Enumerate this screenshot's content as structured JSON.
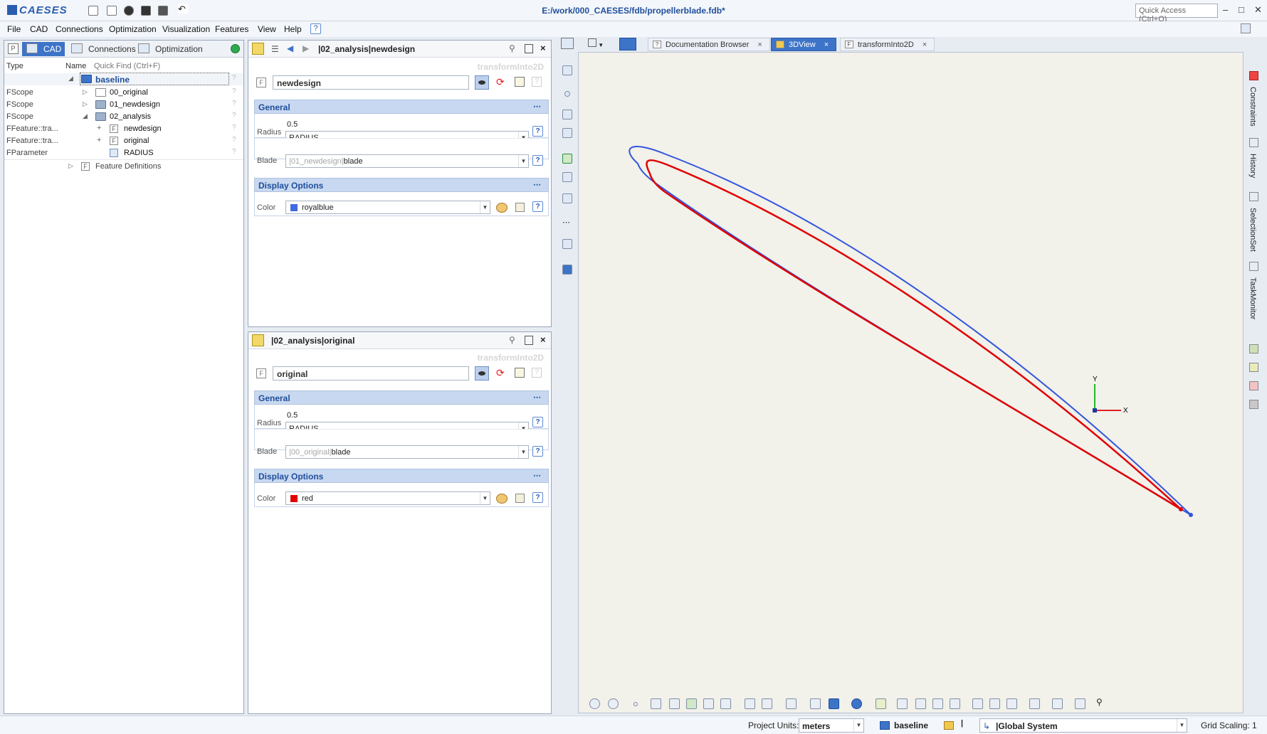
{
  "app": {
    "logo": "CAESES",
    "window_title": "E:/work/000_CAESES/fdb/propellerblade.fdb*",
    "quick_access_placeholder": "Quick Access (Ctrl+Q)"
  },
  "menu": [
    "File",
    "CAD",
    "Connections",
    "Optimization",
    "Visualization",
    "Features",
    "View",
    "Help"
  ],
  "left_panel": {
    "tabs": [
      "CAD",
      "Connections",
      "Optimization"
    ],
    "active_tab": "CAD",
    "columns": {
      "type": "Type",
      "name": "Name",
      "quick_find": "Quick Find (Ctrl+F)"
    },
    "tree": [
      {
        "type": "",
        "name": "baseline"
      },
      {
        "type": "FScope",
        "name": "00_original"
      },
      {
        "type": "FScope",
        "name": "01_newdesign"
      },
      {
        "type": "FScope",
        "name": "02_analysis"
      },
      {
        "type": "FFeature::tra...",
        "name": "newdesign"
      },
      {
        "type": "FFeature::tra...",
        "name": "original"
      },
      {
        "type": "FParameter",
        "name": "RADIUS"
      },
      {
        "type": "",
        "name": "Feature Definitions"
      }
    ]
  },
  "editors": [
    {
      "title": "|02_analysis|newdesign",
      "transform_label": "transformInto2D",
      "name": "newdesign",
      "general_label": "General",
      "radius_label": "Radius",
      "radius_value": "0.5",
      "radius_expr": "RADIUS",
      "blade_label": "Blade",
      "blade_scope": "|01_newdesign|",
      "blade_value": "blade",
      "display_label": "Display Options",
      "color_label": "Color",
      "color_value": "royalblue",
      "color_hex": "#4169e1"
    },
    {
      "title": "|02_analysis|original",
      "transform_label": "transformInto2D",
      "name": "original",
      "general_label": "General",
      "radius_label": "Radius",
      "radius_value": "0.5",
      "radius_expr": "RADIUS",
      "blade_label": "Blade",
      "blade_scope": "|00_original|",
      "blade_value": "blade",
      "display_label": "Display Options",
      "color_label": "Color",
      "color_value": "red",
      "color_hex": "#e00000"
    }
  ],
  "view_tabs": [
    {
      "label": "Documentation Browser",
      "active": false
    },
    {
      "label": "3DView",
      "active": true
    },
    {
      "label": "transformInto2D",
      "active": false
    }
  ],
  "view3d": {
    "axis_y": "Y",
    "axis_x": "X",
    "curve_blue": "#3355dd",
    "curve_red": "#e00000"
  },
  "right_strip": [
    "Constraints",
    "History",
    "SelectionSet",
    "TaskMonitor"
  ],
  "status": {
    "units_label": "Project Units:",
    "units_value": "meters",
    "scope": "baseline",
    "coord_system": "|Global System",
    "grid_scaling": "Grid Scaling: 1"
  }
}
